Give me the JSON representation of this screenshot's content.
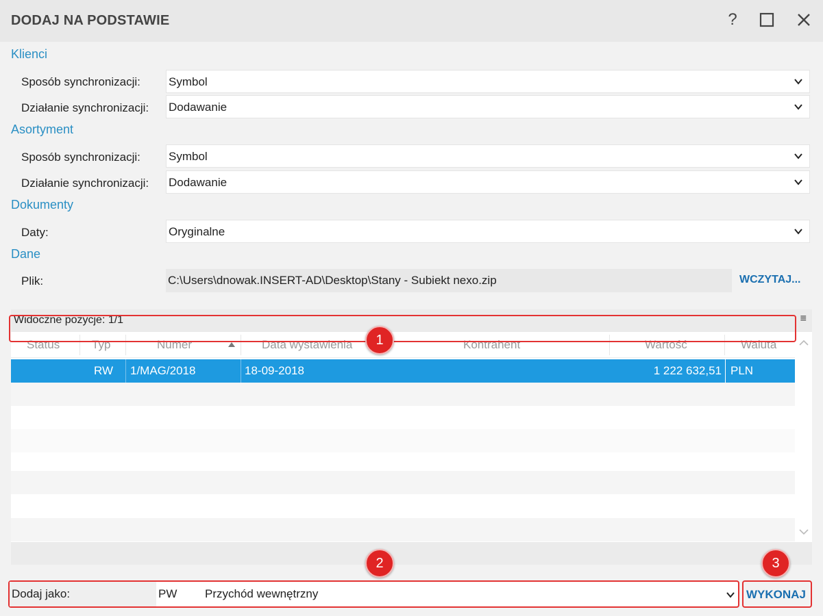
{
  "window": {
    "title": "DODAJ NA PODSTAWIE",
    "help_glyph": "?",
    "max_glyph": "□",
    "close_glyph": "✕"
  },
  "klienci": {
    "heading": "Klienci",
    "sposob_label": "Sposób synchronizacji:",
    "sposob_value": "Symbol",
    "dzialanie_label": "Działanie synchronizacji:",
    "dzialanie_value": "Dodawanie"
  },
  "asortyment": {
    "heading": "Asortyment",
    "sposob_label": "Sposób synchronizacji:",
    "sposob_value": "Symbol",
    "dzialanie_label": "Działanie synchronizacji:",
    "dzialanie_value": "Dodawanie"
  },
  "dokumenty": {
    "heading": "Dokumenty",
    "daty_label": "Daty:",
    "daty_value": "Oryginalne"
  },
  "dane": {
    "heading": "Dane",
    "plik_label": "Plik:",
    "plik_value": "C:\\Users\\dnowak.INSERT-AD\\Desktop\\Stany - Subiekt nexo.zip",
    "load_button": "WCZYTAJ..."
  },
  "grid": {
    "visible_count": "Widoczne pozycje: 1/1",
    "menu_glyph": "≡",
    "columns": [
      "Status",
      "Typ",
      "Numer",
      "Data wystawienia",
      "Kontrahent",
      "Wartość",
      "Waluta"
    ],
    "sort_column": "Numer",
    "rows": [
      {
        "status": "",
        "typ": "RW",
        "numer": "1/MAG/2018",
        "data": "18-09-2018",
        "kontrahent": "",
        "wartosc": "1 222 632,51",
        "waluta": "PLN",
        "selected": true
      }
    ]
  },
  "footer": {
    "dodaj_label": "Dodaj jako:",
    "dodaj_code": "PW",
    "dodaj_name": "Przychód wewnętrzny",
    "execute_button": "WYKONAJ"
  },
  "badges": [
    "1",
    "2",
    "3"
  ],
  "colors": {
    "accent": "#2a8fc4",
    "selection": "#1e9ae0",
    "action_text": "#1a6fb0",
    "highlight": "#e33232"
  }
}
